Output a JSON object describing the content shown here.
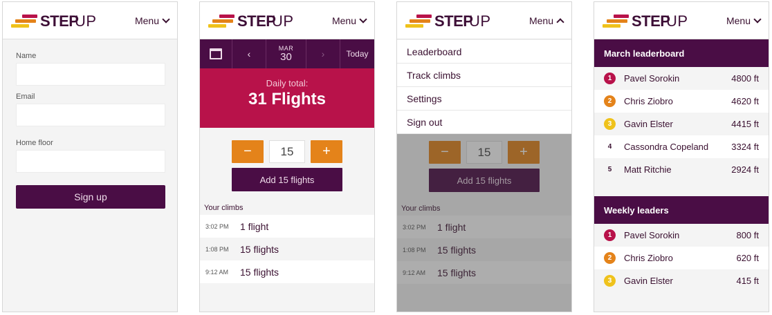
{
  "brand": {
    "step": "STEP",
    "up": "UP"
  },
  "menu": {
    "label": "Menu"
  },
  "colors": {
    "plum": "#4a0d45",
    "crimson": "#b8124a",
    "orange": "#e4831a",
    "yellow": "#efc21b"
  },
  "signup_screen": {
    "fields": [
      {
        "label": "Name",
        "value": ""
      },
      {
        "label": "Email",
        "value": ""
      },
      {
        "label": "Home floor",
        "value": ""
      }
    ],
    "submit_label": "Sign up"
  },
  "track_screen": {
    "date": {
      "month": "MAR",
      "day": "30"
    },
    "prev_label": "‹",
    "next_label": "›",
    "today_label": "Today",
    "calendar_icon": "calendar-icon",
    "daily_total_label": "Daily total:",
    "daily_total_value": "31 Flights",
    "minus_label": "−",
    "plus_label": "+",
    "counter_value": "15",
    "add_label": "Add 15 flights",
    "climbs_title": "Your climbs",
    "climbs": [
      {
        "time": "3:02 PM",
        "amount": "1 flight"
      },
      {
        "time": "1:08 PM",
        "amount": "15 flights"
      },
      {
        "time": "9:12 AM",
        "amount": "15 flights"
      }
    ]
  },
  "menu_screen": {
    "items": [
      "Leaderboard",
      "Track climbs",
      "Settings",
      "Sign out"
    ]
  },
  "leaderboard_screen": {
    "monthly": {
      "title": "March leaderboard",
      "rows": [
        {
          "rank": "1",
          "name": "Pavel Sorokin",
          "score": "4800 ft",
          "badge": "#b8124a"
        },
        {
          "rank": "2",
          "name": "Chris Ziobro",
          "score": "4620 ft",
          "badge": "#e4831a"
        },
        {
          "rank": "3",
          "name": "Gavin Elster",
          "score": "4415 ft",
          "badge": "#efc21b"
        },
        {
          "rank": "4",
          "name": "Cassondra Copeland",
          "score": "3324 ft",
          "badge": ""
        },
        {
          "rank": "5",
          "name": "Matt Ritchie",
          "score": "2924 ft",
          "badge": ""
        }
      ]
    },
    "weekly": {
      "title": "Weekly leaders",
      "rows": [
        {
          "rank": "1",
          "name": "Pavel Sorokin",
          "score": "800 ft",
          "badge": "#b8124a"
        },
        {
          "rank": "2",
          "name": "Chris Ziobro",
          "score": "620 ft",
          "badge": "#e4831a"
        },
        {
          "rank": "3",
          "name": "Gavin Elster",
          "score": "415 ft",
          "badge": "#efc21b"
        }
      ]
    }
  }
}
